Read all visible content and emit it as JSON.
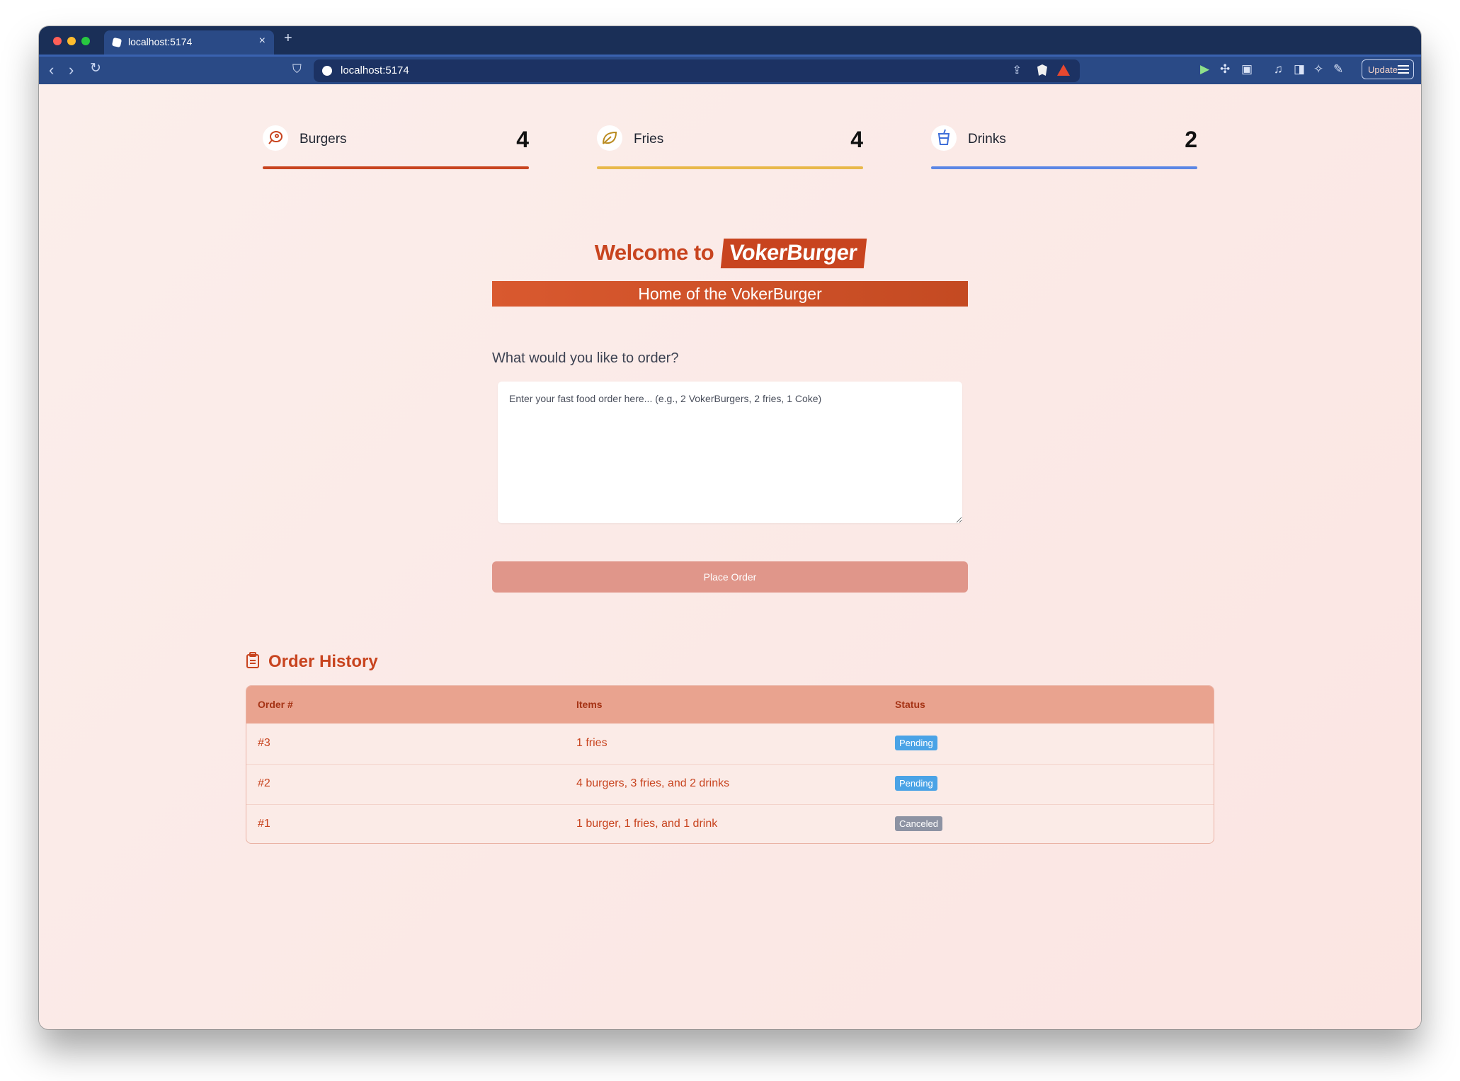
{
  "browser": {
    "tab_title": "localhost:5174",
    "new_tab": "+",
    "close_tab": "×",
    "url": "localhost:5174",
    "update_label": "Update"
  },
  "stats": [
    {
      "label": "Burgers",
      "count": "4",
      "color": "#c8441f",
      "icon": "meat-icon"
    },
    {
      "label": "Fries",
      "count": "4",
      "color": "#e8b84a",
      "icon": "leaf-icon"
    },
    {
      "label": "Drinks",
      "count": "2",
      "color": "#5b86e5",
      "icon": "cup-icon"
    }
  ],
  "hero": {
    "welcome_prefix": "Welcome to",
    "brand": "VokerBurger",
    "subtitle": "Home of the VokerBurger"
  },
  "order_form": {
    "prompt": "What would you like to order?",
    "placeholder": "Enter your fast food order here... (e.g., 2 VokerBurgers, 2 fries, 1 Coke)",
    "value": "",
    "submit_label": "Place Order"
  },
  "history": {
    "title": "Order History",
    "columns": [
      "Order #",
      "Items",
      "Status"
    ],
    "rows": [
      {
        "order": "#3",
        "items": "1 fries",
        "status": "Pending",
        "status_color": "#4aa3e6"
      },
      {
        "order": "#2",
        "items": "4 burgers, 3 fries, and 2 drinks",
        "status": "Pending",
        "status_color": "#4aa3e6"
      },
      {
        "order": "#1",
        "items": "1 burger, 1 fries, and 1 drink",
        "status": "Canceled",
        "status_color": "#8d93a3"
      }
    ]
  },
  "colors": {
    "accent": "#c8441f",
    "button": "#e0968a",
    "table_header": "#e9a38f",
    "chrome": "#2a4a86"
  }
}
